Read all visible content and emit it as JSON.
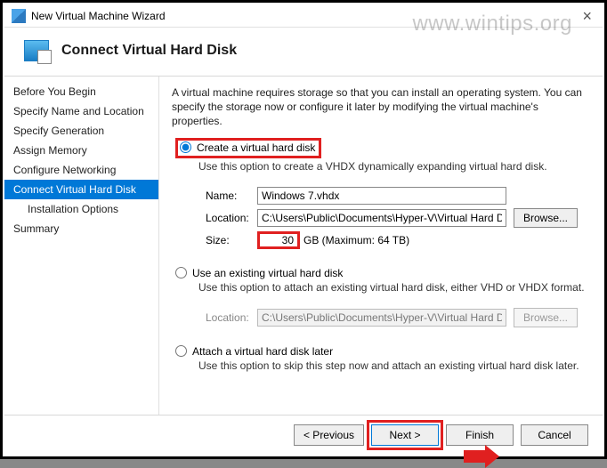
{
  "window": {
    "title": "New Virtual Machine Wizard",
    "watermark": "www.wintips.org"
  },
  "header": {
    "title": "Connect Virtual Hard Disk"
  },
  "sidebar": {
    "items": [
      {
        "label": "Before You Begin",
        "active": false
      },
      {
        "label": "Specify Name and Location",
        "active": false
      },
      {
        "label": "Specify Generation",
        "active": false
      },
      {
        "label": "Assign Memory",
        "active": false
      },
      {
        "label": "Configure Networking",
        "active": false
      },
      {
        "label": "Connect Virtual Hard Disk",
        "active": true
      },
      {
        "label": "Installation Options",
        "active": false,
        "indent": true
      },
      {
        "label": "Summary",
        "active": false
      }
    ]
  },
  "content": {
    "intro": "A virtual machine requires storage so that you can install an operating system. You can specify the storage now or configure it later by modifying the virtual machine's properties.",
    "opt_create": {
      "label": "Create a virtual hard disk",
      "desc": "Use this option to create a VHDX dynamically expanding virtual hard disk.",
      "name_label": "Name:",
      "name_value": "Windows 7.vhdx",
      "loc_label": "Location:",
      "loc_value": "C:\\Users\\Public\\Documents\\Hyper-V\\Virtual Hard Disks\\",
      "browse": "Browse...",
      "size_label": "Size:",
      "size_value": "30",
      "size_suffix": "GB (Maximum: 64 TB)"
    },
    "opt_existing": {
      "label": "Use an existing virtual hard disk",
      "desc": "Use this option to attach an existing virtual hard disk, either VHD or VHDX format.",
      "loc_label": "Location:",
      "loc_value": "C:\\Users\\Public\\Documents\\Hyper-V\\Virtual Hard Disks\\",
      "browse": "Browse..."
    },
    "opt_later": {
      "label": "Attach a virtual hard disk later",
      "desc": "Use this option to skip this step now and attach an existing virtual hard disk later."
    }
  },
  "footer": {
    "previous": "< Previous",
    "next": "Next >",
    "finish": "Finish",
    "cancel": "Cancel"
  }
}
